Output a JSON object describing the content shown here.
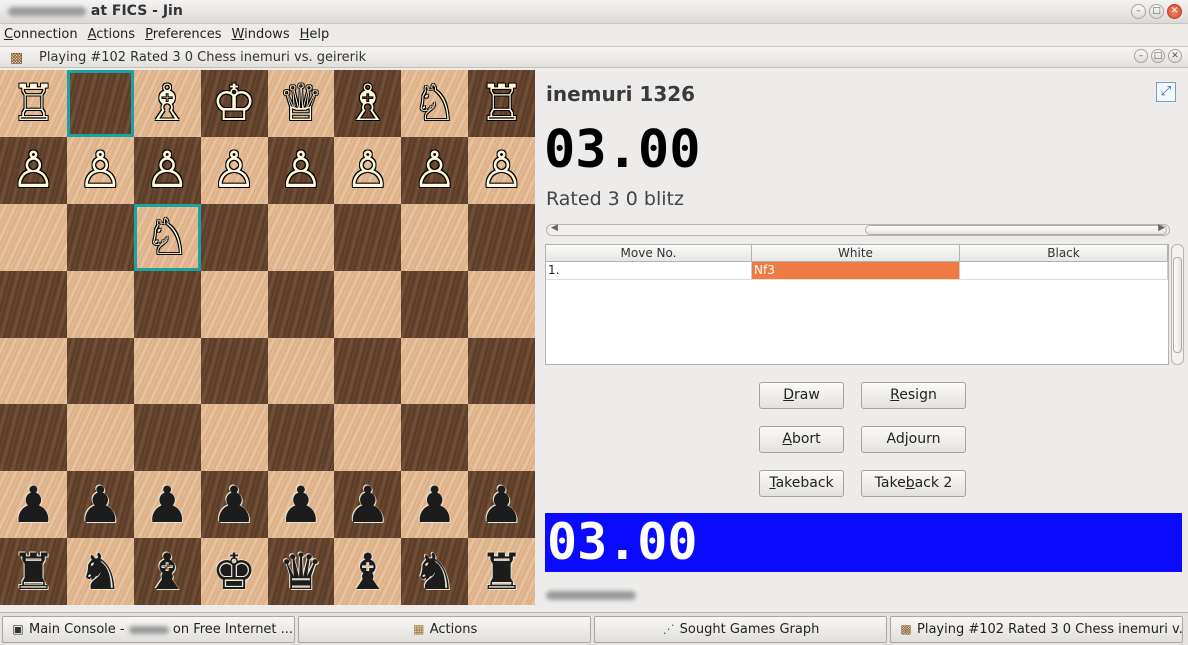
{
  "window": {
    "title_suffix": "at FICS - Jin"
  },
  "menu": [
    {
      "label_u": "C",
      "label_rest": "onnection"
    },
    {
      "label_u": "A",
      "label_rest": "ctions"
    },
    {
      "label_u": "P",
      "label_rest": "references"
    },
    {
      "label_u": "W",
      "label_rest": "indows"
    },
    {
      "label_u": "H",
      "label_rest": "elp"
    }
  ],
  "game_window": {
    "title": "Playing #102 Rated 3 0 Chess inemuri vs. geirerik"
  },
  "board": {
    "rows": [
      [
        "♖",
        "",
        "♗",
        "♔",
        "♕",
        "♗",
        "♘",
        "♖"
      ],
      [
        "♙",
        "♙",
        "♙",
        "♙",
        "♙",
        "♙",
        "♙",
        "♙"
      ],
      [
        "",
        "",
        "♘",
        "",
        "",
        "",
        "",
        ""
      ],
      [
        "",
        "",
        "",
        "",
        "",
        "",
        "",
        ""
      ],
      [
        "",
        "",
        "",
        "",
        "",
        "",
        "",
        ""
      ],
      [
        "",
        "",
        "",
        "",
        "",
        "",
        "",
        ""
      ],
      [
        "♟",
        "♟",
        "♟",
        "♟",
        "♟",
        "♟",
        "♟",
        "♟"
      ],
      [
        "♜",
        "♞",
        "♝",
        "♚",
        "♛",
        "♝",
        "♞",
        "♜"
      ]
    ],
    "highlighted": [
      "0-1",
      "2-2"
    ]
  },
  "top_player": {
    "name": "inemuri 1326",
    "clock": "03.00"
  },
  "game_type": "Rated 3 0 blitz",
  "move_table": {
    "headers": [
      "Move No.",
      "White",
      "Black"
    ],
    "rows": [
      {
        "no": "1.",
        "white": "Nf3",
        "black": ""
      }
    ]
  },
  "buttons": {
    "draw": {
      "u": "D",
      "rest": "raw"
    },
    "resign": {
      "u": "R",
      "rest": "esign"
    },
    "abort": {
      "u": "A",
      "rest": "bort"
    },
    "adjourn": {
      "pre": "Ad",
      "u": "j",
      "rest": "ourn"
    },
    "takeback": {
      "u": "T",
      "rest": "akeback"
    },
    "takeback2": {
      "pre": "Take",
      "u": "b",
      "rest": "ack 2"
    }
  },
  "bottom_player": {
    "clock": "03.00"
  },
  "taskbar": [
    {
      "icon": "console-icon",
      "glyph": "▣",
      "label_a": "Main Console - ",
      "label_b": " on Free Internet ..."
    },
    {
      "icon": "actions-icon",
      "glyph": "▦",
      "label_a": "Actions",
      "label_b": ""
    },
    {
      "icon": "graph-icon",
      "glyph": "⋰",
      "label_a": "Sought Games Graph",
      "label_b": ""
    },
    {
      "icon": "chessboard-icon",
      "glyph": "▩",
      "label_a": "Playing #102 Rated 3 0 Chess inemuri v...",
      "label_b": ""
    }
  ]
}
